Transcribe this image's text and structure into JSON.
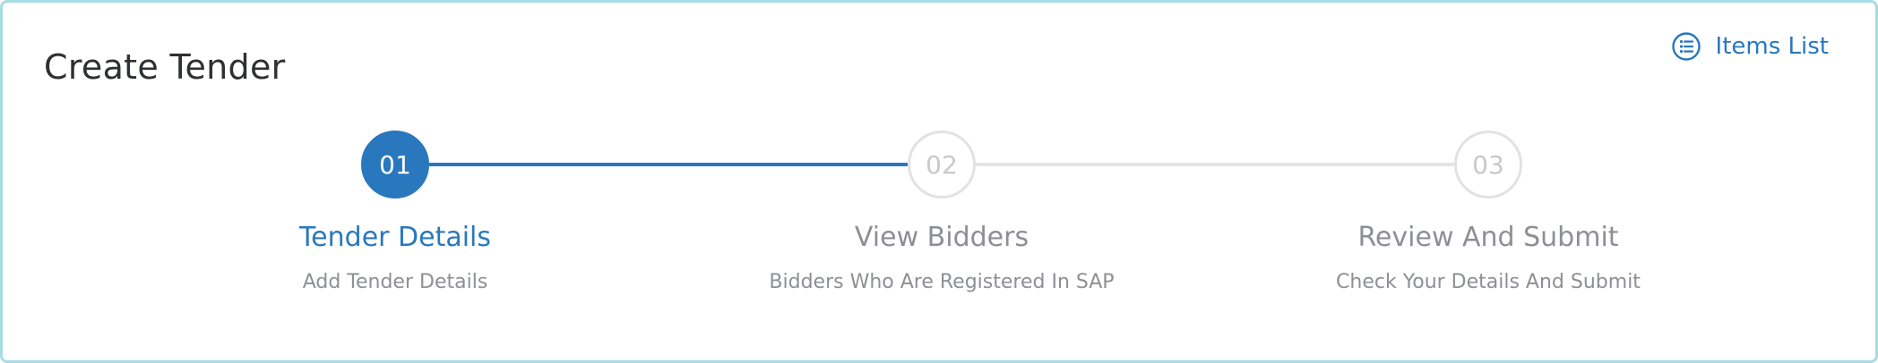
{
  "header": {
    "title": "Create Tender",
    "items_list_label": "Items List",
    "items_list_icon": "list-circle-icon"
  },
  "stepper": {
    "current_step": 1,
    "steps": [
      {
        "number": "01",
        "title": "Tender Details",
        "subtitle": "Add Tender Details",
        "state": "active"
      },
      {
        "number": "02",
        "title": "View Bidders",
        "subtitle": "Bidders Who Are Registered In SAP",
        "state": "inactive"
      },
      {
        "number": "03",
        "title": "Review And Submit",
        "subtitle": "Check Your Details And Submit",
        "state": "inactive"
      }
    ]
  },
  "colors": {
    "accent": "#2978bd",
    "border": "#a6dde3",
    "muted_text": "#8e8f96",
    "inactive_circle": "#e2e2e5",
    "title_text": "#2f3033"
  }
}
